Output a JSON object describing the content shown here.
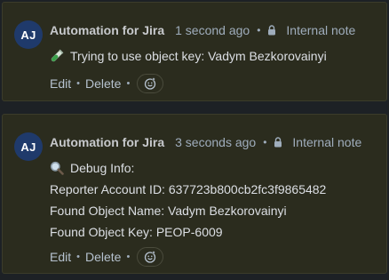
{
  "comments": [
    {
      "avatar_initials": "AJ",
      "author": "Automation for Jira",
      "time": "1 second ago",
      "separator": "•",
      "visibility": "Internal note",
      "lines": [
        {
          "emoji": "test-tube-icon",
          "text": "Trying to use object key: Vadym Bezkorovainyi"
        }
      ],
      "actions": {
        "edit": "Edit",
        "delete": "Delete",
        "dot": "•"
      }
    },
    {
      "avatar_initials": "AJ",
      "author": "Automation for Jira",
      "time": "3 seconds ago",
      "separator": "•",
      "visibility": "Internal note",
      "lines": [
        {
          "emoji": "magnifying-glass-icon",
          "text": "Debug Info:"
        },
        {
          "text": "Reporter Account ID: 637723b800cb2fc3f9865482"
        },
        {
          "text": "Found Object Name: Vadym Bezkorovainyi"
        },
        {
          "text": "Found Object Key: PEOP-6009"
        }
      ],
      "actions": {
        "edit": "Edit",
        "delete": "Delete",
        "dot": "•"
      }
    }
  ],
  "colors": {
    "page_bg": "#1d2125",
    "comment_bg": "#2b2c1e",
    "avatar_bg": "#1f3a6b",
    "text": "#dcdfe4",
    "muted": "#9fadbc"
  }
}
